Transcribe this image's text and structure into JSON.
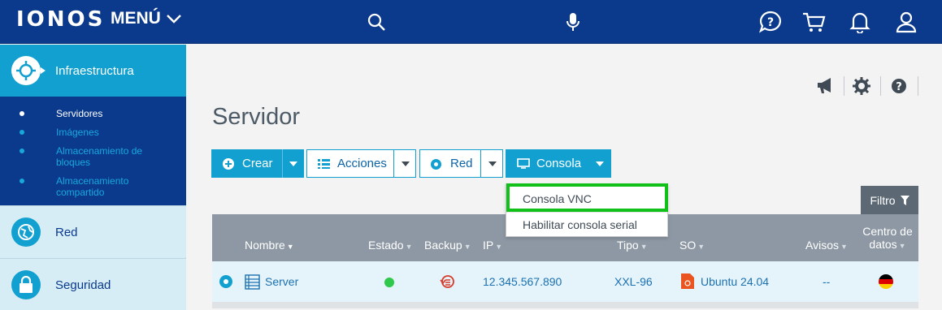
{
  "topbar": {
    "logo": "IONOS",
    "menu_label": "MENÚ"
  },
  "sidebar": {
    "section_active": "Infraestructura",
    "sub_items": [
      "Servidores",
      "Imágenes",
      "Almacenamiento de bloques",
      "Almacenamiento compartido"
    ],
    "section_red": "Red",
    "section_security": "Seguridad"
  },
  "main": {
    "title": "Servidor",
    "toolbar": {
      "create": "Crear",
      "actions": "Acciones",
      "network": "Red",
      "console": "Consola"
    },
    "console_menu": [
      "Consola VNC",
      "Habilitar consola serial"
    ],
    "filter_label": "Filtro",
    "table": {
      "headers": {
        "name": "Nombre",
        "status": "Estado",
        "backup": "Backup",
        "ip": "IP",
        "type": "Tipo",
        "os": "SO",
        "alerts": "Avisos",
        "datacenter_line1": "Centro de",
        "datacenter_line2": "datos"
      },
      "row": {
        "name": "Server",
        "ip": "12.345.567.890",
        "type": "XXL-96",
        "os": "Ubuntu 24.04",
        "alerts": "--"
      }
    }
  },
  "colors": {
    "navy": "#0b3a8c",
    "accent_blue": "#11a0d0",
    "highlight_green": "#12c01a",
    "status_green": "#2ec84a"
  }
}
